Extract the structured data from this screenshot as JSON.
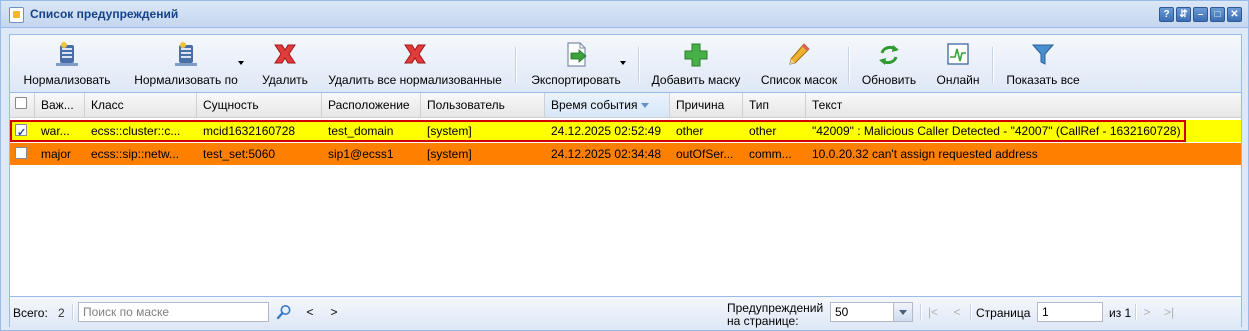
{
  "window": {
    "title": "Список предупреждений"
  },
  "toolbar": {
    "normalize": "Нормализовать",
    "normalize_by": "Нормализовать по",
    "delete": "Удалить",
    "delete_all_normalized": "Удалить все нормализованные",
    "export": "Экспортировать",
    "add_mask": "Добавить маску",
    "mask_list": "Список масок",
    "refresh": "Обновить",
    "online": "Онлайн",
    "show_all": "Показать все"
  },
  "grid": {
    "columns": {
      "severity": "Важ...",
      "class": "Класс",
      "entity": "Сущность",
      "location": "Расположение",
      "user": "Пользователь",
      "event_time": "Время события",
      "reason": "Причина",
      "type": "Тип",
      "text": "Текст"
    },
    "sorted_column": "event_time",
    "rows": [
      {
        "checked": true,
        "severity": "war...",
        "class": "ecss::cluster::c...",
        "entity": "mcid1632160728",
        "location": "test_domain",
        "user": "[system]",
        "event_time": "24.12.2025 02:52:49",
        "reason": "other",
        "type": "other",
        "text": "\"42009\" : Malicious Caller Detected - \"42007\" (CallRef - 1632160728)",
        "color": "#ffff00"
      },
      {
        "checked": false,
        "severity": "major",
        "class": "ecss::sip::netw...",
        "entity": "test_set:5060",
        "location": "sip1@ecss1",
        "user": "[system]",
        "event_time": "24.12.2025 02:34:48",
        "reason": "outOfSer...",
        "type": "comm...",
        "text": "10.0.20.32 can't assign requested address",
        "color": "#ff8000"
      }
    ]
  },
  "status": {
    "total_label": "Всего:",
    "total_value": "2",
    "search_placeholder": "Поиск по маске",
    "prev": "<",
    "next": ">",
    "per_page_label_1": "Предупреждений",
    "per_page_label_2": "на странице:",
    "per_page_value": "50",
    "page_label": "Страница",
    "page_value": "1",
    "of_label": "из 1"
  },
  "colors": {
    "warning": "#ffff00",
    "major": "#ff8000",
    "accent": "#15428b",
    "selection_border": "#d00000"
  }
}
